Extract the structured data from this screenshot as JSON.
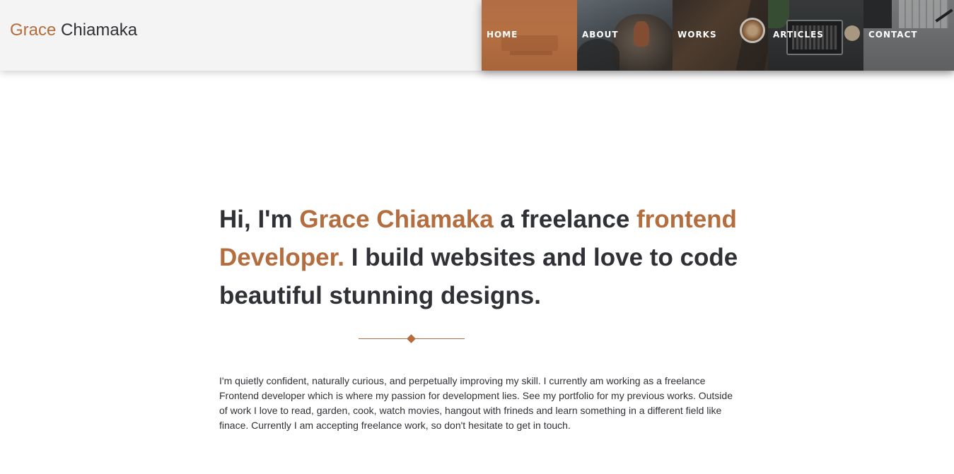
{
  "header": {
    "brand_first": "Grace",
    "brand_last": "Chiamaka",
    "nav": [
      {
        "label": "HOME",
        "active": true
      },
      {
        "label": "ABOUT",
        "active": false
      },
      {
        "label": "WORKS",
        "active": false
      },
      {
        "label": "ARTICLES",
        "active": false
      },
      {
        "label": "CONTACT",
        "active": false
      }
    ]
  },
  "hero": {
    "part1": "Hi, I'm ",
    "name": "Grace Chiamaka",
    "part2": " a freelance ",
    "role": "frontend Developer.",
    "part3": " I build websites and love to code beautiful stunning designs."
  },
  "about": {
    "text": "I'm quietly confident, naturally curious, and perpetually improving my skill. I currently am working as a freelance Frontend developer which is where my passion for development lies. See my portfolio for my previous works. Outside of work I love to read, garden, cook, watch movies, hangout with frineds and learn something in a different field like finace. Currently I am accepting freelance work, so don't hesitate to get in touch."
  },
  "colors": {
    "accent": "#b36d3e",
    "text": "#2f3136",
    "header_bg": "#f4f4f4"
  }
}
